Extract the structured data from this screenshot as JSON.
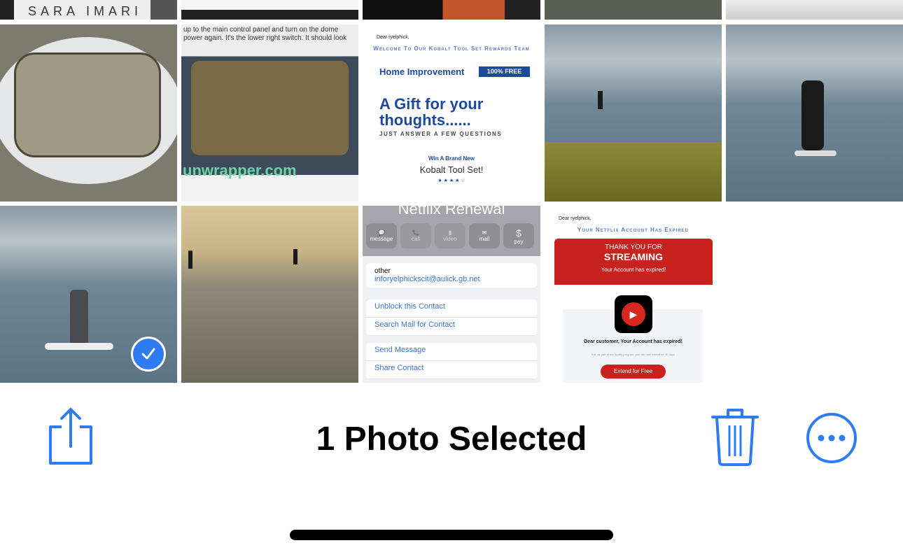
{
  "photos": {
    "top_row": {
      "book_text": "SARA IMARI"
    },
    "board_caption": "up to the main control panel and turn on the dome power again. It's the lower right switch. It should look",
    "board_watermark": "unwrapper.com",
    "kobalt": {
      "greeting": "Dear ryelphick,",
      "welcome": "Welcome To Our Kobalt Tool Set Rewards Team",
      "category": "Home Improvement",
      "badge": "100% FREE",
      "headline": "A Gift for your thoughts......",
      "subhead": "JUST ANSWER A FEW QUESTIONS",
      "win": "Win A Brand New",
      "prize": "Kobalt Tool Set!",
      "stars": "★ ★ ★ ★ ☆"
    },
    "contact": {
      "name": "Netflix Renewal",
      "actions": [
        "message",
        "call",
        "video",
        "mail",
        "pay"
      ],
      "email_label": "other",
      "email": "inforyelphickscit@aulick.gb.net",
      "options": [
        "Unblock this Contact",
        "Search Mail for Contact",
        "Send Message",
        "Share Contact"
      ]
    },
    "netflix": {
      "greeting": "Dear ryelphick,",
      "title": "Your Netflix Account Has Expired",
      "banner_top": "THANK YOU FOR",
      "banner_main": "STREAMING",
      "banner_sub": "Your Account has expired!",
      "body_title": "Dear customer, Your Account has expired!",
      "body_text": "But, as part of our loyalty program, you can now extend for 90 days",
      "button": "Extend for Free"
    }
  },
  "toolbar": {
    "title": "1 Photo Selected",
    "share_icon": "share-icon",
    "trash_icon": "trash-icon",
    "more_icon": "ellipsis-circle-icon",
    "accent": "#2f7bf1"
  }
}
